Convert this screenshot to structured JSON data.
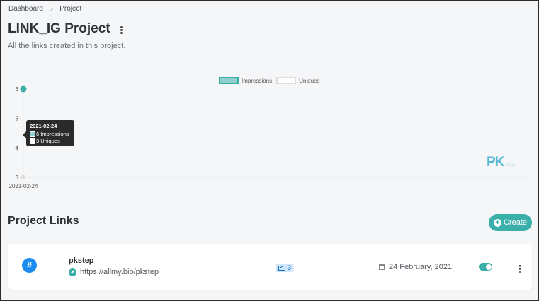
{
  "breadcrumb": {
    "items": [
      "Dashboard",
      "Project"
    ],
    "separator": ">"
  },
  "header": {
    "title": "LINK_IG Project",
    "subtitle": "All the links created in this project."
  },
  "chart_data": {
    "type": "line",
    "x": [
      "2021-02-24"
    ],
    "series": [
      {
        "name": "Impressions",
        "values": [
          6
        ],
        "color": "#3aafa9"
      },
      {
        "name": "Uniques",
        "values": [
          3
        ],
        "color": "#dddddd"
      }
    ],
    "ylim": [
      3,
      6
    ],
    "yticks": [
      "3",
      "4",
      "5",
      "6"
    ],
    "xticks": [
      "2021-02-24"
    ],
    "legend": "top-center",
    "tooltip": {
      "title": "2021-02-24",
      "lines": [
        "6 Impressions",
        "3 Uniques"
      ]
    }
  },
  "watermark": {
    "main": "PK",
    "sub": "ninja"
  },
  "section": {
    "title": "Project Links",
    "create_label": "Create"
  },
  "links": [
    {
      "name": "pkstep",
      "url": "https://allmy.bio/pkstep",
      "stat": "3",
      "date": "24 February, 2021",
      "enabled": true
    }
  ],
  "colors": {
    "accent": "#3aafa9",
    "hash": "#1a8cf0"
  }
}
